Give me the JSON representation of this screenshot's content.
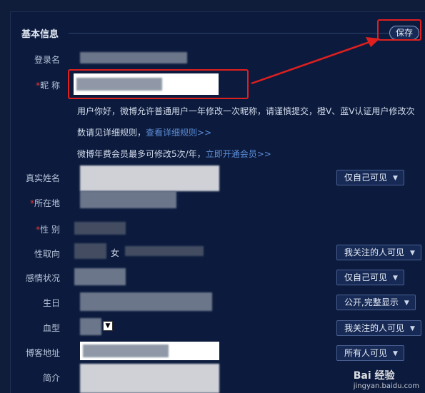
{
  "section": {
    "title": "基本信息",
    "save_label": "保存"
  },
  "fields": {
    "login": {
      "label": "登录名"
    },
    "nickname": {
      "label": "昵 称",
      "required": "*"
    },
    "realname": {
      "label": "真实姓名"
    },
    "location": {
      "label": "所在地",
      "required": "*"
    },
    "gender": {
      "label": "性 别",
      "required": "*"
    },
    "orientation": {
      "label": "性取向",
      "partial_text": "女"
    },
    "relationship": {
      "label": "感情状况"
    },
    "birthday": {
      "label": "生日"
    },
    "blood": {
      "label": "血型",
      "select_caret": "▼"
    },
    "blog": {
      "label": "博客地址"
    },
    "intro": {
      "label": "简介"
    }
  },
  "notes": {
    "line1": "用户你好，微博允许普通用户一年修改一次昵称，请谨慎提交，橙V、蓝V认证用户修改次",
    "line2_text": "数请见详细规则，",
    "line2_link": "查看详细规则>>",
    "line3_text": "微博年费会员最多可修改5次/年，",
    "line3_link": "立即开通会员>>"
  },
  "privacy": {
    "realname": "仅自己可见",
    "orientation": "我关注的人可见",
    "relationship": "仅自己可见",
    "birthday": "公开,完整显示",
    "blood": "我关注的人可见",
    "blog": "所有人可见"
  },
  "watermark": {
    "brand": "Bai 经验",
    "url": "jingyan.baidu.com"
  },
  "colors": {
    "background": "#0c1b3d",
    "highlight": "#e01f1f",
    "link": "#5b8cd6"
  }
}
